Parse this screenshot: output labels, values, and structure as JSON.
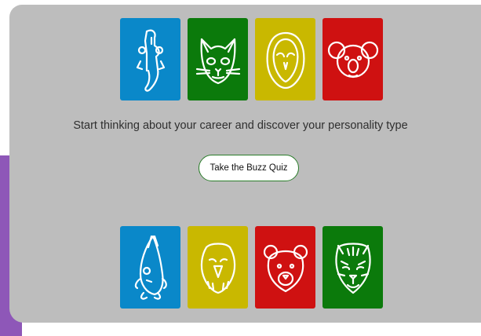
{
  "tagline": "Start thinking about your career and discover your personality type",
  "quiz_button_label": "Take the Buzz Quiz",
  "colors": {
    "blue": "#0a88c9",
    "green": "#0b7a0b",
    "yellow": "#c9b800",
    "red": "#cf1111",
    "purple": "#8e57b8",
    "panel": "#bdbdbd"
  },
  "animals_top": [
    "seahorse-icon",
    "cat-icon",
    "owl-icon",
    "koala-icon"
  ],
  "animals_bottom": [
    "fish-icon",
    "eagle-icon",
    "bear-icon",
    "tiger-icon"
  ]
}
